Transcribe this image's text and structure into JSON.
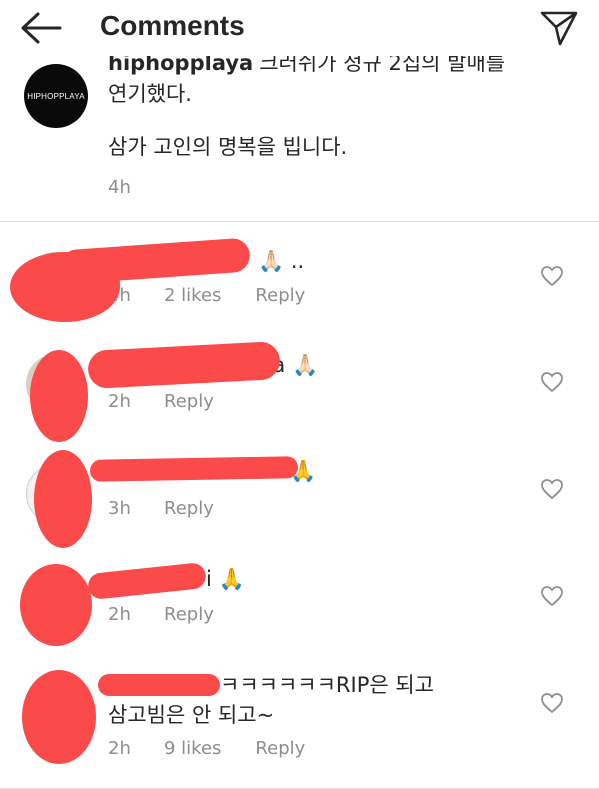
{
  "header": {
    "title": "Comments",
    "back_icon": "arrow-left-icon",
    "send_icon": "send-icon"
  },
  "caption": {
    "avatar_text": "HIPHOPPLAYA",
    "username": "hiphopplaya",
    "line1": "크러쉬가 정규 2집의 발매를",
    "line1b": "연기했다.",
    "line2": "삼가 고인의 명복을 빕니다.",
    "time": "4h"
  },
  "comments": [
    {
      "text": "🙏🏻 ..",
      "time": "4h",
      "likes": "2 likes",
      "reply": "Reply"
    },
    {
      "text": "ya 🙏🏻",
      "time": "2h",
      "likes": "",
      "reply": "Reply"
    },
    {
      "text": "🙏",
      "time": "3h",
      "likes": "",
      "reply": "Reply"
    },
    {
      "text": "i 🙏",
      "time": "2h",
      "likes": "",
      "reply": "Reply"
    },
    {
      "text": "ㅋㅋㅋㅋㅋㅋRIP은 되고",
      "text2": "삼고빔은 안 되고~",
      "time": "2h",
      "likes": "9 likes",
      "reply": "Reply"
    }
  ],
  "colors": {
    "redaction": "#fb4a4a",
    "meta": "#8e8e8e",
    "text": "#262626"
  }
}
